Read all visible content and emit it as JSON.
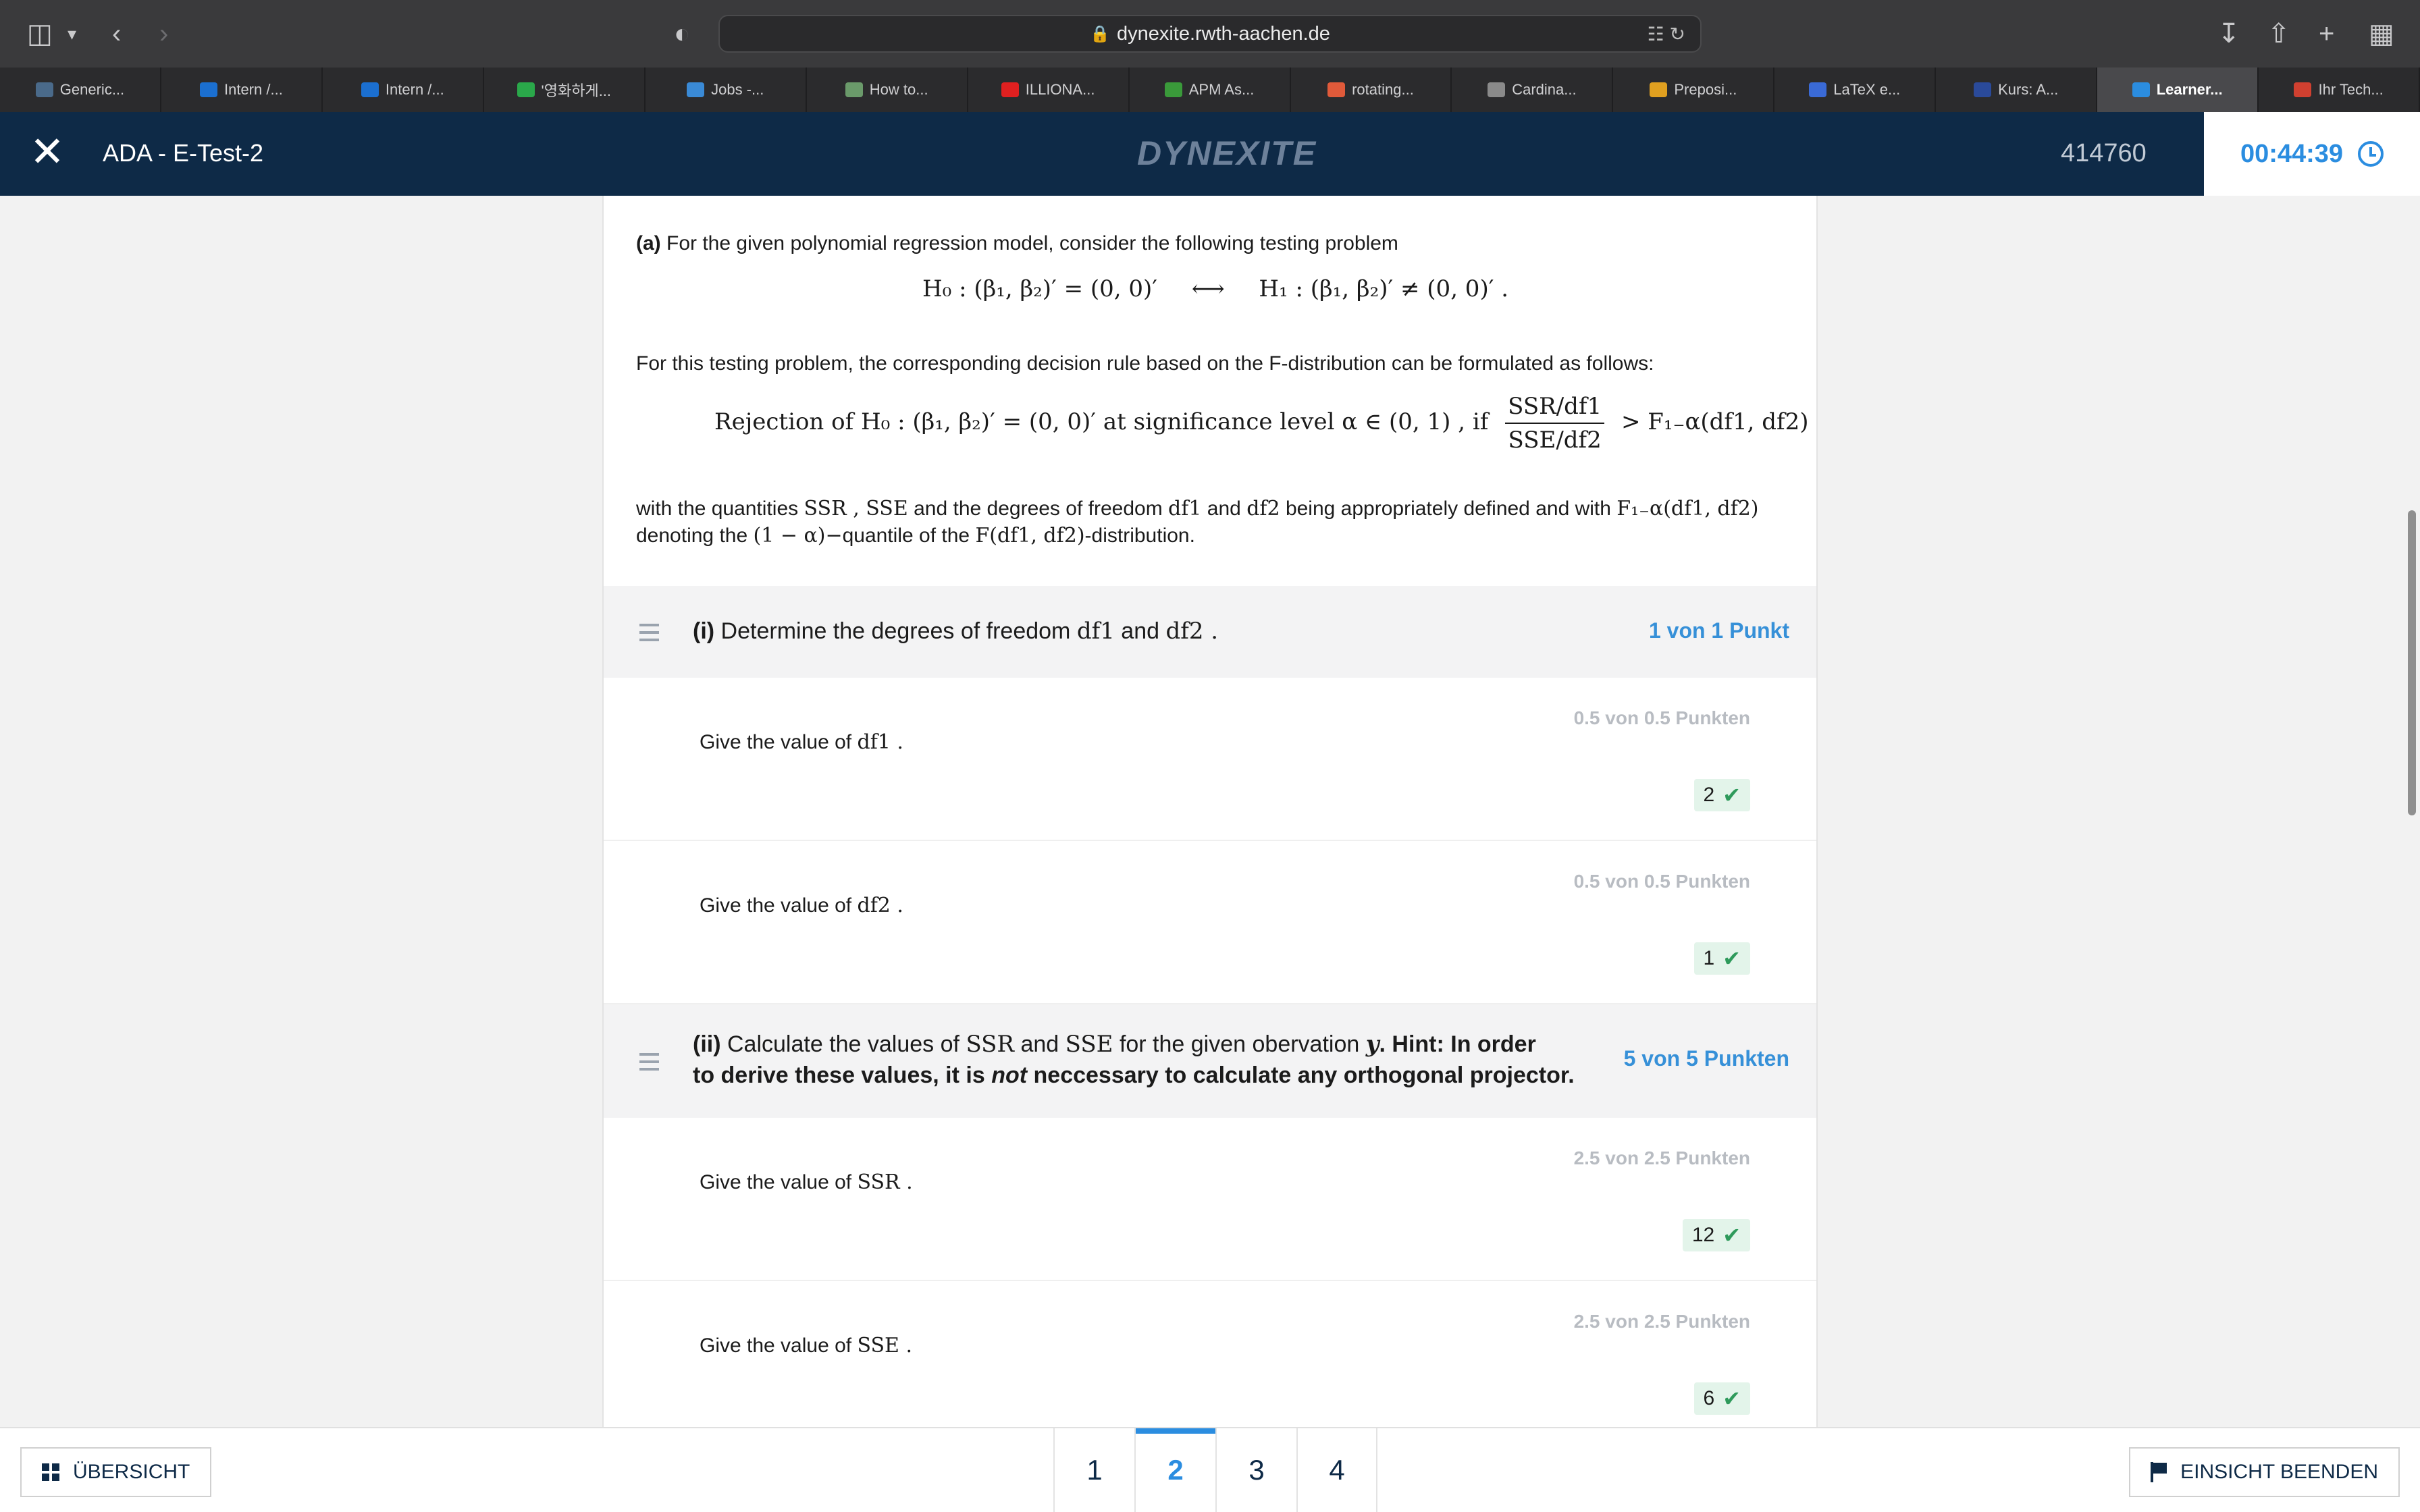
{
  "browser": {
    "url": "dynexite.rwth-aachen.de",
    "tabs": [
      {
        "label": "Generic...",
        "icon": "globe-icon",
        "color": "#4a6a8a"
      },
      {
        "label": "Intern /...",
        "icon": "sap-icon",
        "color": "#1b6fd0"
      },
      {
        "label": "Intern /...",
        "icon": "sap-icon",
        "color": "#1b6fd0"
      },
      {
        "label": "'영화하게...",
        "icon": "ga-icon",
        "color": "#2aa84a"
      },
      {
        "label": "Jobs -...",
        "icon": "jobs-icon",
        "color": "#3a8ad6"
      },
      {
        "label": "How to...",
        "icon": "pen-icon",
        "color": "#6a9a6a"
      },
      {
        "label": "ILLIONA...",
        "icon": "youtube-icon",
        "color": "#e02020"
      },
      {
        "label": "APM As...",
        "icon": "leaf-icon",
        "color": "#3a9a3a"
      },
      {
        "label": "rotating...",
        "icon": "braces-icon",
        "color": "#e05a3a"
      },
      {
        "label": "Cardina...",
        "icon": "image-icon",
        "color": "#8a8a8a"
      },
      {
        "label": "Preposi...",
        "icon": "bookmark-icon",
        "color": "#e0a020"
      },
      {
        "label": "LaTeX e...",
        "icon": "letter-a-icon",
        "color": "#3a6ad6"
      },
      {
        "label": "Kurs: A...",
        "icon": "rwth-icon",
        "color": "#2a4a9a"
      },
      {
        "label": "Learner...",
        "icon": "dynexite-icon",
        "color": "#2b8de0",
        "active": true
      },
      {
        "label": "Ihr Tech...",
        "icon": "gmail-icon",
        "color": "#d04030"
      }
    ]
  },
  "header": {
    "exam_title": "ADA - E-Test-2",
    "brand": "DYNEXITE",
    "candidate_id": "414760",
    "timer": "00:44:39"
  },
  "task": {
    "intro_label": "(a)",
    "intro_text": "For the given polynomial regression model, consider the following testing problem",
    "hypothesis": {
      "h0": "H₀ : (β₁, β₂)′ = (0, 0)′",
      "arrow": "⟷",
      "h1": "H₁ : (β₁, β₂)′ ≠ (0, 0)′ ."
    },
    "rule_intro": "For this testing problem, the corresponding decision rule based on the F-distribution can be formulated as follows:",
    "rule": {
      "prefix": "Rejection of H₀ : (β₁, β₂)′ = (0, 0)′ at significance level α ∈ (0, 1) , if",
      "numerator": "SSR/df1",
      "denominator": "SSE/df2",
      "suffix": "> F₁₋α(df1, df2)"
    },
    "def_line1_a": "with the quantities",
    "def_line1_b": "SSR , SSE",
    "def_line1_c": "and the degrees of freedom",
    "def_line1_d": "df1",
    "def_line1_e": "and",
    "def_line1_f": "df2",
    "def_line1_g": "being appropriately defined and with",
    "def_line1_h": "F₁₋α(df1, df2)",
    "def_line2_a": "denoting the",
    "def_line2_b": "(1 − α)−",
    "def_line2_c": "quantile of the",
    "def_line2_d": "F(df1, df2)",
    "def_line2_e": "-distribution."
  },
  "part_i": {
    "label": "(i)",
    "title_a": "Determine the degrees of freedom",
    "title_b": "df1",
    "title_c": "and",
    "title_d": "df2 .",
    "points": "1 von 1 Punkt",
    "questions": [
      {
        "text_a": "Give the value of",
        "text_b": "df1 .",
        "points": "0.5 von 0.5 Punkten",
        "answer": "2"
      },
      {
        "text_a": "Give the value of",
        "text_b": "df2 .",
        "points": "0.5 von 0.5 Punkten",
        "answer": "1"
      }
    ]
  },
  "part_ii": {
    "label": "(ii)",
    "title_a": "Calculate the values of",
    "title_b": "SSR",
    "title_c": "and",
    "title_d": "SSE",
    "title_e": "for the given obervation",
    "title_f": "y",
    "title_g": ". Hint: In order",
    "title_h": "to derive these values, it is",
    "title_i": "not",
    "title_j": "neccessary to calculate any orthogonal projector.",
    "points": "5 von 5 Punkten",
    "questions": [
      {
        "text_a": "Give the value of",
        "text_b": "SSR .",
        "points": "2.5 von 2.5 Punkten",
        "answer": "12"
      },
      {
        "text_a": "Give the value of",
        "text_b": "SSE .",
        "points": "2.5 von 2.5 Punkten",
        "answer": "6"
      }
    ]
  },
  "footer": {
    "overview_label": "ÜBERSICHT",
    "pages": [
      "1",
      "2",
      "3",
      "4"
    ],
    "active_page": "2",
    "end_label": "EINSICHT BEENDEN"
  }
}
